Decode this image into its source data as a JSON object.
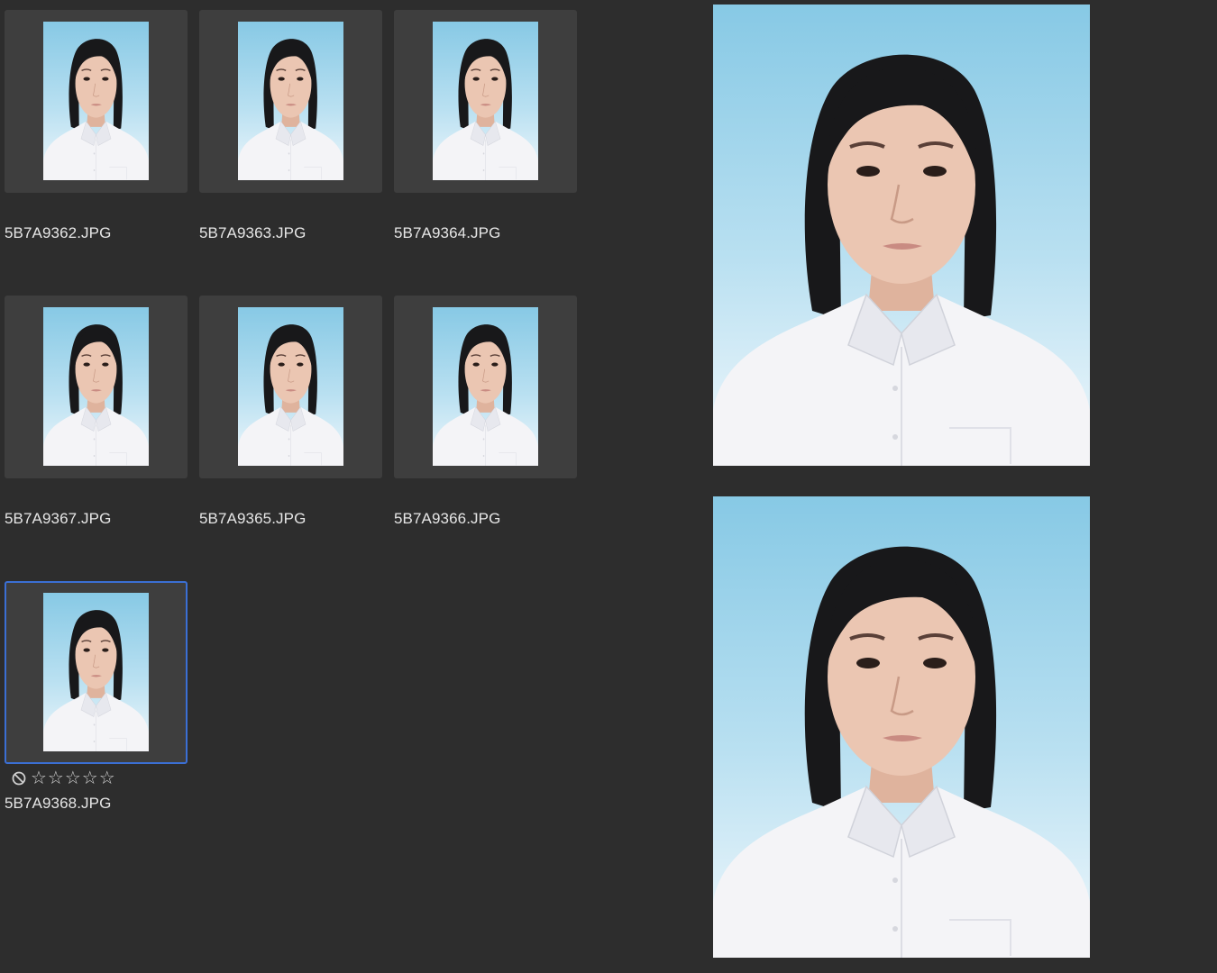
{
  "grid": {
    "items": [
      {
        "filename": "5B7A9362.JPG"
      },
      {
        "filename": "5B7A9363.JPG"
      },
      {
        "filename": "5B7A9364.JPG"
      },
      {
        "filename": "5B7A9367.JPG"
      },
      {
        "filename": "5B7A9365.JPG"
      },
      {
        "filename": "5B7A9366.JPG"
      },
      {
        "filename": "5B7A9368.JPG",
        "selected": true,
        "rating": 0,
        "max_rating": 5,
        "stars": "☆☆☆☆☆"
      }
    ]
  },
  "colors": {
    "background": "#2d2d2d",
    "thumb_frame": "#3e3e3e",
    "selection_border": "#3b6fd4",
    "sky_top": "#88cbe6",
    "sky_bottom": "#eef7fc",
    "hair": "#1a1a1c",
    "shirt": "#f3f3f6",
    "skin": "#e9c2ad"
  },
  "icons": {
    "reject": "reject-flag-icon",
    "star": "star-outline-icon"
  },
  "preview": {
    "photo_count": 2
  }
}
